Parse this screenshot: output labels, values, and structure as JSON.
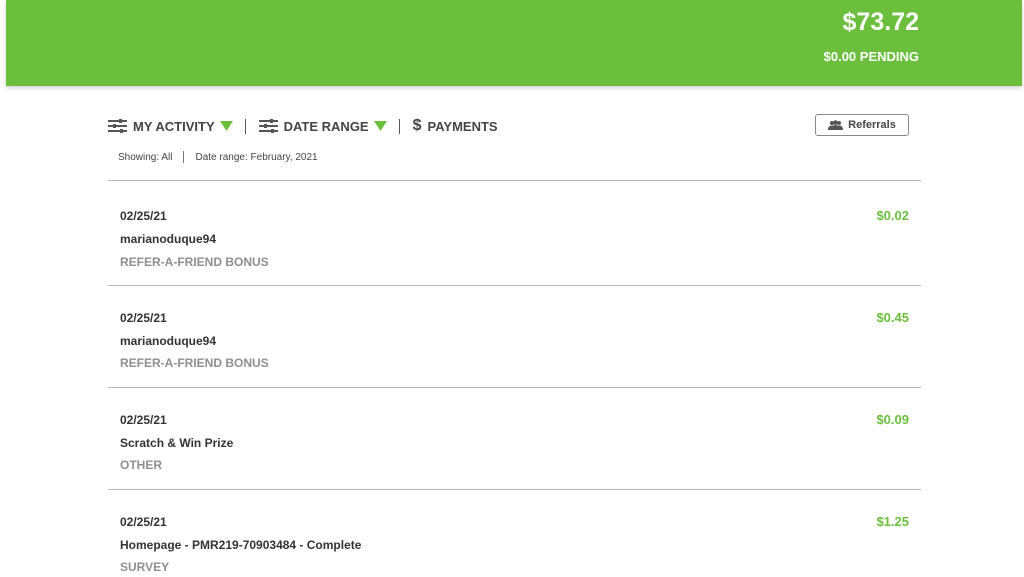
{
  "balance": {
    "amount": "$73.72",
    "pending": "$0.00 PENDING"
  },
  "toolbar": {
    "my_activity": "MY ACTIVITY",
    "date_range": "DATE RANGE",
    "payments": "PAYMENTS",
    "referrals": "Referrals",
    "dollar_symbol": "$"
  },
  "filters": {
    "showing": "Showing: All",
    "date_range": "Date range: February, 2021"
  },
  "colors": {
    "brand_green": "#6bbf3d"
  },
  "transactions": [
    {
      "date": "02/25/21",
      "title": "marianoduque94",
      "category": "REFER-A-FRIEND BONUS",
      "amount": "$0.02"
    },
    {
      "date": "02/25/21",
      "title": "marianoduque94",
      "category": "REFER-A-FRIEND BONUS",
      "amount": "$0.45"
    },
    {
      "date": "02/25/21",
      "title": "Scratch & Win Prize",
      "category": "OTHER",
      "amount": "$0.09"
    },
    {
      "date": "02/25/21",
      "title": "Homepage - PMR219-70903484 - Complete",
      "category": "SURVEY",
      "amount": "$1.25"
    }
  ]
}
